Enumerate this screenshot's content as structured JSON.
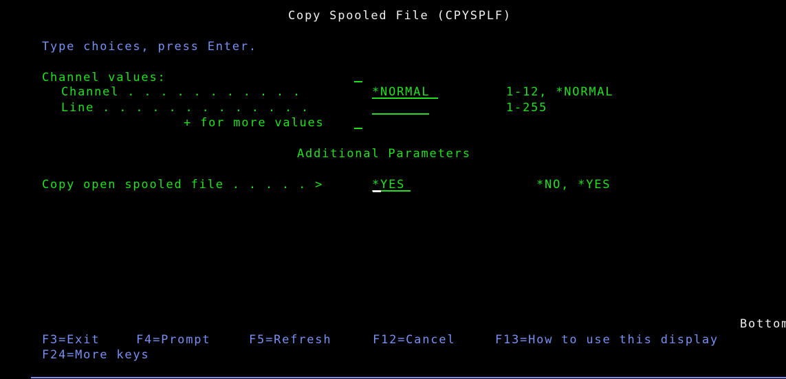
{
  "screen": {
    "title": "Copy Spooled File (CPYSPLF)",
    "instruction": "Type choices, press Enter.",
    "channel_values_label": "Channel values:",
    "channel": {
      "label": "Channel . . . . . . . . . . .",
      "value": "*NORMAL",
      "allowed": "1-12, *NORMAL"
    },
    "line": {
      "label": "Line . . . . . . . . . . . . .",
      "value": "",
      "allowed": "1-255"
    },
    "more_values": "+ for more values",
    "section_heading": "Additional Parameters",
    "copy_open": {
      "label": "Copy open spooled file . . . . . >",
      "value": "*YES",
      "allowed": "*NO, *YES"
    },
    "position": "Bottom"
  },
  "function_keys": [
    {
      "label": "F3=Exit"
    },
    {
      "label": "F4=Prompt"
    },
    {
      "label": "F5=Refresh"
    },
    {
      "label": "F12=Cancel"
    },
    {
      "label": "F13=How to use this display"
    },
    {
      "label": "F24=More keys"
    }
  ],
  "colors": {
    "background": "#000000",
    "title": "#f0f0f0",
    "instruction": "#7890f0",
    "field": "#20e020"
  }
}
